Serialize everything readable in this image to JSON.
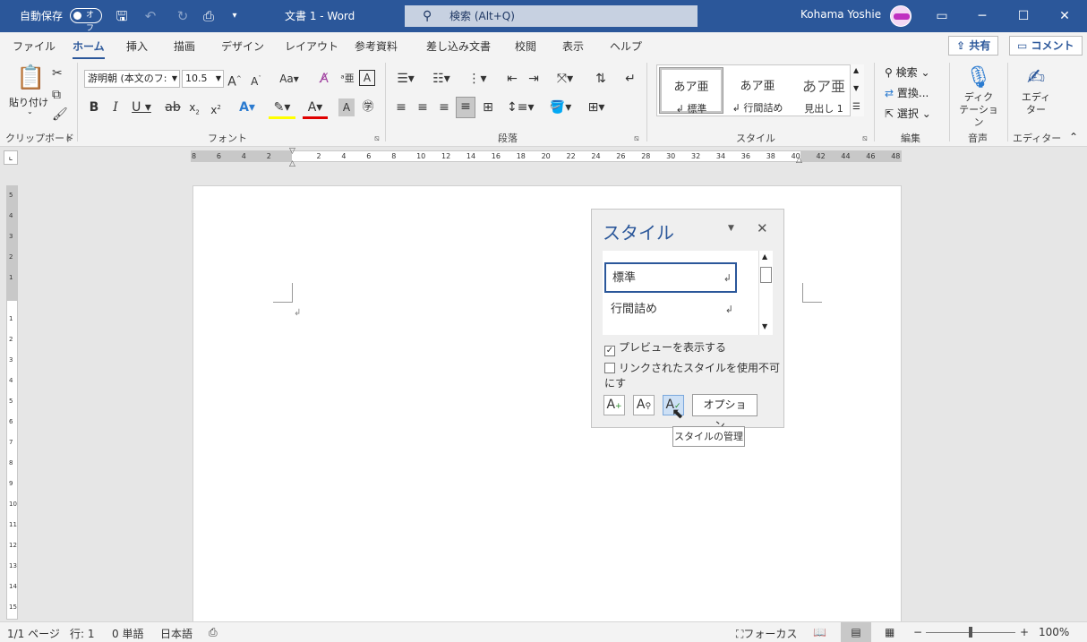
{
  "titlebar": {
    "autosave_label": "自動保存",
    "autosave_state": "オフ",
    "doc_title": "文書 1  -  Word",
    "search_placeholder": "検索 (Alt+Q)",
    "user_name": "Kohama Yoshie"
  },
  "tabs": [
    "ファイル",
    "ホーム",
    "挿入",
    "描画",
    "デザイン",
    "レイアウト",
    "参考資料",
    "差し込み文書",
    "校閲",
    "表示",
    "ヘルプ"
  ],
  "active_tab": "ホーム",
  "share_label": "共有",
  "comment_label": "コメント",
  "ribbon": {
    "paste_label": "貼り付け",
    "font_name": "游明朝 (本文のフ:",
    "font_size": "10.5",
    "groups": {
      "clipboard": "クリップボード",
      "font": "フォント",
      "paragraph": "段落",
      "styles": "スタイル",
      "editing": "編集",
      "voice": "音声",
      "editor": "エディター"
    },
    "styles_gallery": [
      {
        "preview": "あア亜",
        "name": "↲ 標準"
      },
      {
        "preview": "あア亜",
        "name": "↲ 行間詰め"
      },
      {
        "preview": "あア亜",
        "name": "見出し 1"
      }
    ],
    "editing": {
      "find": "検索",
      "replace": "置換...",
      "select": "選択"
    },
    "dictate": "ディク\nテーション",
    "editor": "エディ\nター"
  },
  "hruler_numbers": [
    "8",
    "6",
    "4",
    "2",
    "",
    "2",
    "4",
    "6",
    "8",
    "10",
    "12",
    "14",
    "16",
    "18",
    "20",
    "22",
    "24",
    "26",
    "28",
    "30",
    "32",
    "34",
    "36",
    "38",
    "40",
    "42",
    "44",
    "46",
    "48"
  ],
  "vruler_numbers": [
    "5",
    "4",
    "3",
    "2",
    "1",
    "",
    "1",
    "2",
    "3",
    "4",
    "5",
    "6",
    "7",
    "8",
    "9",
    "10",
    "11",
    "12",
    "13",
    "14",
    "15"
  ],
  "styles_pane": {
    "title": "スタイル",
    "items": [
      "標準",
      "行間詰め"
    ],
    "show_preview": "プレビューを表示する",
    "disable_linked": "リンクされたスタイルを使用不可にす",
    "options_label": "オプション...",
    "tooltip": "スタイルの管理"
  },
  "status": {
    "page": "1/1 ページ",
    "line": "行: 1",
    "words": "0 単語",
    "language": "日本語",
    "focus": "フォーカス",
    "zoom": "100%"
  }
}
